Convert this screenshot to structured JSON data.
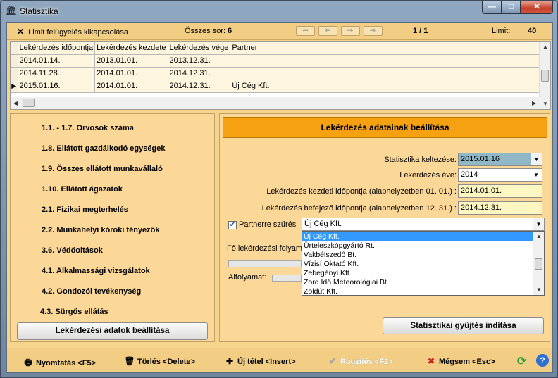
{
  "window": {
    "title": "Statisztika",
    "min_glyph": "—",
    "max_glyph": "□",
    "close_glyph": "✕"
  },
  "toolbar_top": {
    "limit_toggle_label": "Limit felügyelés kikapcsolása",
    "total_rows_label": "Összes sor:",
    "total_rows_value": "6",
    "page_indicator": "1 / 1",
    "limit_label": "Limit:",
    "limit_value": "40"
  },
  "grid": {
    "columns": [
      "Lekérdezés időpontja",
      "Lekérdezés kezdete",
      "Lekérdezés vége",
      "Partner"
    ],
    "rows": [
      [
        "2014.01.14.",
        "2013.01.01.",
        "2013.12.31.",
        ""
      ],
      [
        "2014.11.28.",
        "2014.01.01.",
        "2014.12.31.",
        ""
      ],
      [
        "2015.01.16.",
        "2014.01.01.",
        "2014.12.31.",
        "Új Cég Kft."
      ]
    ],
    "current_row": 2
  },
  "left_panel": {
    "items": [
      "1.1. - 1.7. Orvosok száma",
      "1.8. Ellátott gazdálkodó egységek",
      "1.9. Összes ellátott munkavállaló",
      "1.10. Ellátott ágazatok",
      "2.1. Fizikai megterhelés",
      "2.2. Munkahelyi kóroki tényezők",
      "3.6. Védőoltások",
      "4.1. Alkalmassági vizsgálatok",
      "4.2. Gondozói tevékenység",
      "4.3. Sürgős ellátás"
    ],
    "button_label": "Lekérdezési adatok beállítása"
  },
  "right_panel": {
    "header": "Lekérdezés adatainak beállítása",
    "date_label": "Statisztika keltezése:",
    "date_value": "2015.01.16",
    "year_label": "Lekérdezés éve:",
    "year_value": "2014",
    "start_label": "Lekérdezés kezdeti időpontja (alaphelyzetben 01. 01.) :",
    "start_value": "2014.01.01.",
    "end_label": "Lekérdezés befejező időpontja (alaphelyzetben 12. 31.) :",
    "end_value": "2014.12.31.",
    "partner_filter_label": "Partnerre szűrés",
    "partner_filter_checked": true,
    "partner_value": "Új Cég Kft.",
    "partner_options": [
      "Új Cég Kft.",
      "Ürteleszkópgyártó Rt.",
      "Vakbélszedő Bt.",
      "Vízisí Oktató Kft.",
      "Zebegényi Kft.",
      "Zord Idő Meteorológiai Bt.",
      "Zöldút Kft."
    ],
    "main_process_label": "Fő lekérdezési folyam",
    "sub_process_label": "Alfolyamat:",
    "start_button": "Statisztikai gyűjtés indítása"
  },
  "toolbar_bottom": {
    "print": "Nyomtatás <F5>",
    "delete": "Törlés <Delete>",
    "new_item": "Új tétel <Insert>",
    "save": "Rögzítés <F2>",
    "cancel": "Mégsem <Esc>"
  }
}
